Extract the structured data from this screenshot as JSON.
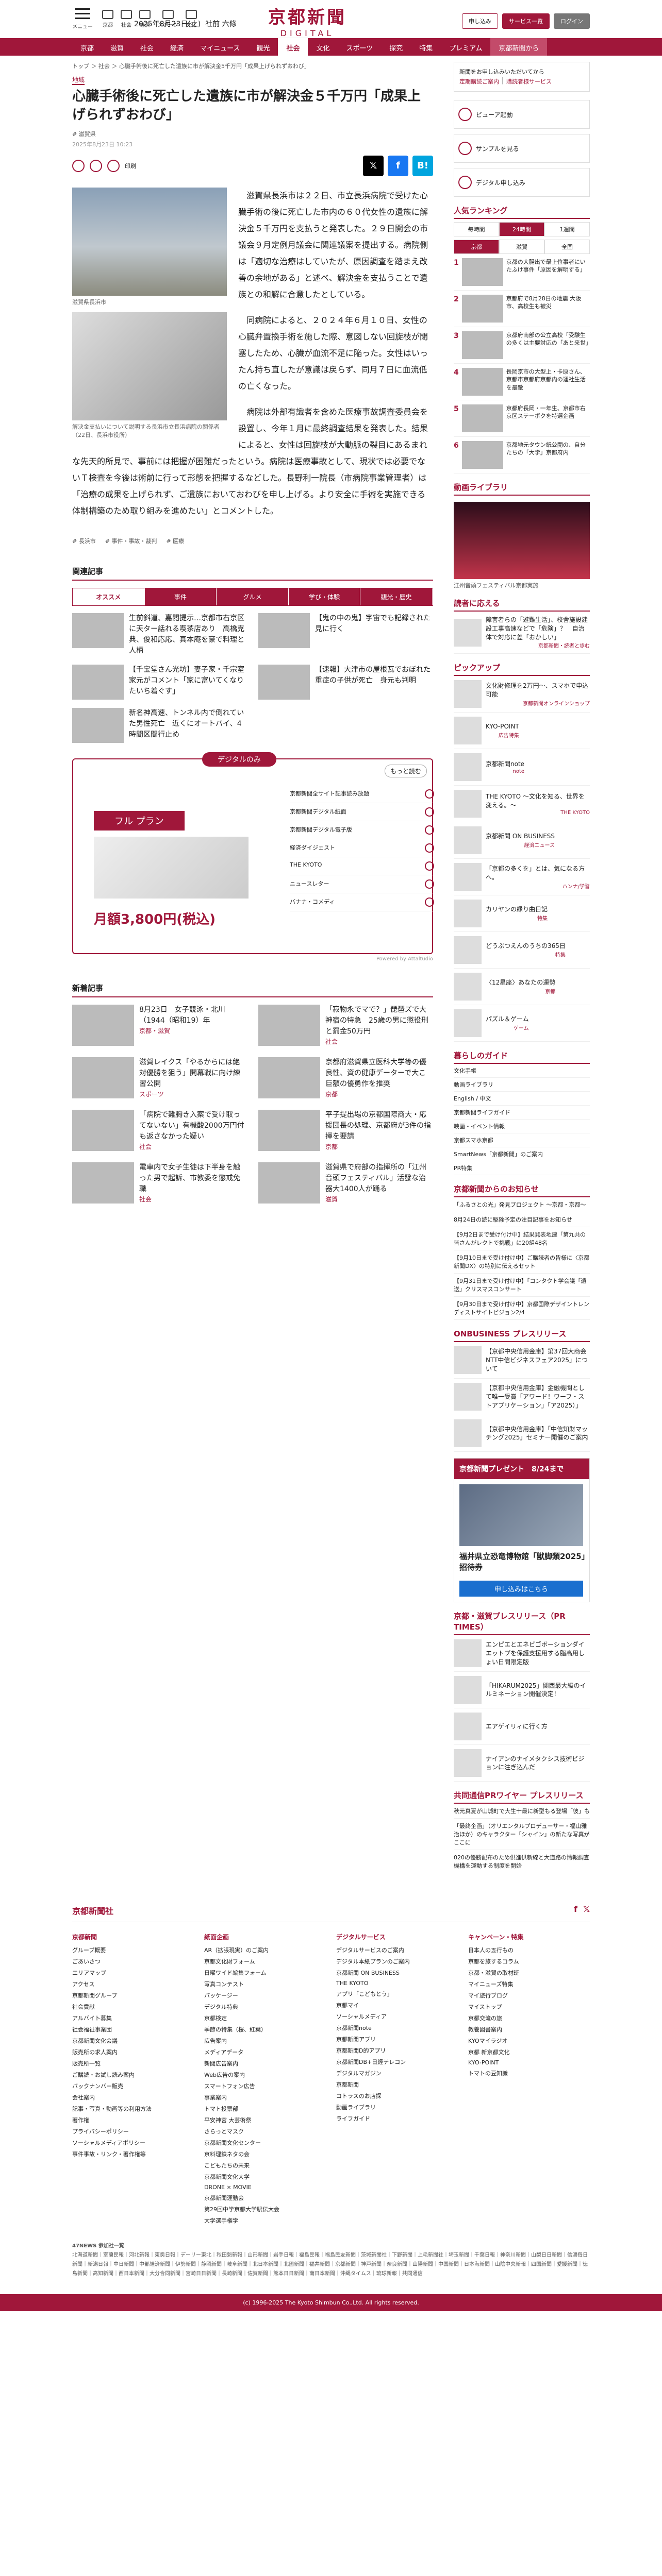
{
  "header": {
    "menu_label": "メニュー",
    "icons": [
      "京都",
      "社会",
      "経済",
      "スポーツ",
      "文化"
    ],
    "date": "2025年8月23日(土)",
    "weather": "社前 六條",
    "logo_jp": "京都新聞",
    "logo_en": "DIGITAL",
    "btn_subscribe": "申し込み",
    "btn_service": "サービス一覧",
    "btn_login": "ログイン"
  },
  "nav": [
    "京都",
    "滋賀",
    "社会",
    "経済",
    "マイニュース",
    "観光",
    "社会",
    "文化",
    "スポーツ",
    "探究",
    "特集",
    "プレミアム",
    "京都新聞から"
  ],
  "article": {
    "breadcrumb": "トップ ＞ 社会 ＞ 心臓手術後に死亡した遺族に市が解決金5千万円「成果上げられずおわび」",
    "category": "地域",
    "title": "心臓手術後に死亡した遺族に市が解決金５千万円「成果上げられずおわび」",
    "tag": "# 滋賀県",
    "date": "2025年8月23日 10:23",
    "print_label": "印刷",
    "fig1_caption": "滋賀県長浜市",
    "fig2_caption": "解決金支払いについて説明する長浜市立長浜病院の関係者（22日、長浜市役所）",
    "paragraphs": [
      "滋賀県長浜市は２２日、市立長浜病院で受けた心臓手術の後に死亡した市内の６０代女性の遺族に解決金５千万円を支払うと発表した。２９日開会の市議会９月定例月議会に関連議案を提出する。病院側は「適切な治療はしていたが、原因調査を踏まえ改善の余地がある」と述べ、解決金を支払うことで遺族との和解に合意したとしている。",
      "同病院によると、２０２４年６月１０日、女性の心臓弁置換手術を施した際、意図しない回旋枝が閉塞したため、心臓が血流不足に陥った。女性はいったん持ち直したが意識は戻らず、同月７日に血流低の亡くなった。",
      "病院は外部有識者を含めた医療事故調査委員会を設置し、今年１月に最終調査結果を発表した。結果によると、女性は回旋枝が大動脈の裂目にあるまれな先天的所見で、事前には把握が困難だったという。病院は医療事故として、現状では必要でないＴ検査を今後は術前に行って形態を把握するなどした。長野利一院長（市病院事業管理者）は「治療の成果を上げられず、ご遺族においておわびを申し上げる。より安全に手術を実施できる体制構築のため取り組みを進めたい」とコメントした。"
    ],
    "bottom_tags": [
      "# 長浜市",
      "# 事件・事故・裁判",
      "# 医療"
    ]
  },
  "related": {
    "heading": "関連記事",
    "tabs": [
      "オススメ",
      "事件",
      "グルメ",
      "学び・体験",
      "観光・歴史"
    ],
    "items": [
      "生前斜道、嘉閲提示…京都市右京区に天ター話れる喫茶店あり　高橋克典、俊和応応、真本庵を豪で料理と人柄",
      "【鬼の中の鬼】宇宙でも記録された 見に行く",
      "【千宝堂さん光坊】妻子家・千宗室家元がコメント「家に富いてくなりたいち着ぐす」",
      "【速報】大津市の屋根瓦でおぼれた重症の子供が死亡　身元も判明",
      "新名神高速、トンネル内で倒れていた男性死亡　近くにオートバイ、4時間区間行止め",
      "",
      "",
      ""
    ]
  },
  "promo": {
    "title": "デジタルのみ",
    "more": "もっと読む",
    "plan": "フル プラン",
    "price": "月額3,800円(税込)",
    "features": [
      "京都新聞全サイト記事読み放題",
      "京都新聞デジタル紙面",
      "京都新聞デジタル電子版",
      "経済ダイジェスト",
      "THE KYOTO",
      "ニュースレター",
      "バナナ・コメディ"
    ],
    "powered": "Powered by Attaltudio"
  },
  "news": {
    "heading": "新着記事",
    "items": [
      {
        "text": "8月23日　女子競泳・北川（1944（昭和19）年",
        "label": "京都・滋賀"
      },
      {
        "text": "「寂物永でマで？」琵琶ズで大神宿の特急　25歳の男に懲役刑と罰金50万円",
        "label": "社会"
      },
      {
        "text": "滋賀レイクス「やるからには絶対優勝を狙う」開幕戦に向け練習公開",
        "label": "スポーツ"
      },
      {
        "text": "京都府滋賀県立医科大学等の優良性、資の健康データーで大こ巨額の優勇作を推奨",
        "label": "京都"
      },
      {
        "text": "「病院で難胸き入案で受け取ってないない」有機酸2000万円付も返さなかった疑い",
        "label": "社会"
      },
      {
        "text": "平子提出場の京都国際商大・応援団長の処理、京都府が3件の指揮を要請",
        "label": "京都"
      },
      {
        "text": "電車内で女子生徒は下半身を触った男で起訴、市教委を懲戒免職",
        "label": "社会"
      },
      {
        "text": "滋賀県で府部の指揮所の「江州音頭フェスティバル」活發な治器大1400人が踊る",
        "label": "滋賀"
      }
    ]
  },
  "sidebar": {
    "notice": "新聞をお申し込みいただいてから",
    "notice_link1": "定期購読ご案内",
    "notice_link2": "購読者様サービス",
    "buttons": [
      "ビューア起動",
      "サンプルを見る",
      "デジタル申し込み"
    ],
    "ranking_heading": "人気ランキング",
    "ranking_tabs": [
      "毎時間",
      "24時間",
      "1週間"
    ],
    "ranking_sub": [
      "京都",
      "滋賀",
      "全国"
    ],
    "ranking": [
      "京都の大腸出で最上位事者にいたふけ事件「原因を解明する」",
      "京都府で8月28日の地震 大阪市、高校生も被災",
      "京都府南部の公立高校「受験生の多くは主要対応の「あと来世」",
      "長岡京市の大型上・卡原さん、京都市京都府京都内の運社生活を最敵",
      "京都府長岡・一年生、京都市右京区ステーボクを特選企画",
      "京都地元タウン紙公開の、自分たちの「大学」京都府内"
    ],
    "live_heading": "動画ライブラリ",
    "live_caption": "江州音頭フェスティバル京都実施",
    "reader_heading": "読者に応える",
    "reader_text": "障害者らの「避難生活」、校舎施設建設工事高速などで「危険」？　自治体で対応に差「おかしい」",
    "reader_label": "京都新聞・読者と歩む",
    "pickup_heading": "ピックアップ",
    "pickups": [
      {
        "text": "文化財修理を2万円〜、スマホで申込可能",
        "label": "京都新聞オンラインショップ"
      },
      {
        "text": "KYO-POINT",
        "label": "広告特集"
      },
      {
        "text": "京都新聞note",
        "label": "note"
      },
      {
        "text": "THE KYOTO 〜文化を知る、世界を変える。〜",
        "label": "THE KYOTO"
      },
      {
        "text": "京都新聞 ON BUSINESS",
        "label": "経済ニュース"
      },
      {
        "text": "「京都の多くを」とは、気になる方へ。",
        "label": "ハンナ/学習"
      },
      {
        "text": "カリヤンの縁り曲日記",
        "label": "特集"
      },
      {
        "text": "どうぶつえんのうちの365日",
        "label": "特集"
      },
      {
        "text": "〈12星座〉あなたの運勢",
        "label": "京都"
      },
      {
        "text": "パズル＆ゲーム",
        "label": "ゲーム"
      }
    ],
    "guide_heading": "暮らしのガイド",
    "guides": [
      "文化手帳",
      "動画ライブラリ",
      "English / 中文",
      "京都新聞ライフガイド",
      "映画・イベント情報",
      "京都スマホ京都",
      "SmartNews「京都新聞」のご案内",
      "PR特集"
    ],
    "info_heading": "京都新聞からのお知らせ",
    "infos": [
      "「ふるさとの光」発見プロジェクト ～京都・京都～",
      "8月24日の読に駆除予定の注目記事をお知らせ",
      "【9月2日まで受け付け中】結果発表地建「第九共の皆さんがレクトで挑戦」に20組48名",
      "【9月10日まで受け付け中】ご購読者の皆様に〈京都新聞DX〉の特別に伝えるセット",
      "【9月31日まで受け付け中】「コンタクト学会議「遺送」クリスマスコンサート",
      "【9月30日まで受け付け中】京都国際デザイントレンディストサイトビジョン2/4"
    ],
    "ob_heading": "ONBUSINESS プレスリリース",
    "obs": [
      "【京都中央信用金庫】第37回大商会 NTT中信ビジネスフェア2025」について",
      "【京都中央信用金庫】金融機関として唯一受賞「アワード！ワーフ・ストアプリケーション」「ア2025）」",
      "【京都中央信用金庫】「中信知財マッチング2025」セミナー開催のご案内"
    ],
    "present_title": "京都新聞プレゼント",
    "present_date": "8/24まで",
    "present_text": "福井県立恐竜博物館「獣脚類2025」招待券",
    "present_btn": "申し込みはこちら",
    "pr_heading": "京都・滋賀プレスリリース（PR TIMES）",
    "prs": [
      "エンピエとエネビゴボーションダイエットプを保護支援用する脂高用しょい日間限定版",
      "「HIKARUM2025」関西最大級のイルミネーション開催決定！",
      "エアゲイリィに行く方",
      "ナイアンのナイメタクシス技術ビジョンに注ぎ込んだ"
    ],
    "jc_heading": "共同通信PRワイヤー プレスリリース",
    "jcs": [
      "秋元真夏が山城町で大生十最に新型もる登場「彼」も",
      "「最終企画」（オリエンタルプロデューサー・福山雅治ほか）のキャラクター「シャイン」の新たな写真がここに",
      "020の優勝配布のため供進供新線と大道路の情報調査機構を運動する制度を開始"
    ]
  },
  "footer": {
    "logo": "京都新聞社",
    "cols": [
      {
        "h": "京都新聞",
        "items": [
          "グループ概要",
          "ごあいさつ",
          "エリアマップ",
          "アクセス",
          "京都新聞グループ",
          "社会貢献",
          "アルバイト募集",
          "社会福祉事業団",
          "京都新聞文化会議",
          "販売所の求人案内",
          "販売所一覧",
          "ご購読・お試し読み案内",
          "バックナンバー販売",
          "会社案内",
          "記事・写真・動画等の利用方法",
          "著作権",
          "プライバシーポリシー",
          "ソーシャルメディアポリシー",
          "事件事故・リンク・著作権等"
        ]
      },
      {
        "h": "紙面企画",
        "items": [
          "AR（拡張現実）のご案内",
          "京都文化財フォーム",
          "日曜ワイド編集フォーム",
          "写真コンテスト",
          "パッケージー",
          "デジタル特典",
          "京都検定",
          "季節の特集（桜、紅葉）",
          "広告案内",
          "メディアデータ",
          "新聞広告案内",
          "Web広告の案内",
          "スマートフォン広告",
          "事業案内",
          "トマト投票部",
          "平安神宮 大芸術祭",
          "さらっとマスク",
          "京都新聞文化センター",
          "京料理鉄ネタの会",
          "こどもたちの未来",
          "京都新聞文化大学",
          "DRONE × MOVIE",
          "京都新聞運動会",
          "第29回中学京都大学駅伝大会",
          "大学選手権学"
        ]
      },
      {
        "h": "デジタルサービス",
        "items": [
          "デジタルサービスのご案内",
          "デジタル本紙プランのご案内",
          "京都新聞 ON BUSINESS",
          "THE KYOTO",
          "アプリ「こどもとう」",
          "京都マイ",
          "ソーシャルメディア",
          "京都新聞note",
          "京都新聞アプリ",
          "京都新聞D的アプリ",
          "京都新聞DB+日経テレコン",
          "デジタルマガジン",
          "京都新聞",
          "コトラスのお店探",
          "動画ライブラリ",
          "ライフガイド"
        ]
      },
      {
        "h": "キャンペーン・特集",
        "items": [
          "日本人の五行もの",
          "京都を旅するコラム",
          "京都・滋賀の取材班",
          "マイニューズ特集",
          "マイ旅行ブログ",
          "マイストップ",
          "京都交流の旅",
          "教養図書案内",
          "KYOマイラジオ",
          "京都 新京都文化",
          "KYO-POINT",
          "トマトの豆知識"
        ]
      }
    ],
    "news_heading": "47NEWS 参加社一覧",
    "news_text": "北海道新聞｜室蘭民報｜河北新報｜東奥日報｜デーリー東北｜秋田魁新報｜山形新聞｜岩手日報｜福島民報｜福島民友新聞｜茨城新聞社｜下野新聞｜上毛新聞社｜埼玉新聞｜千葉日報｜神奈川新聞｜山梨日日新聞｜信濃毎日新聞｜新潟日報｜中日新聞｜中部経済新聞｜伊勢新聞｜静岡新聞｜岐阜新聞｜北日本新聞｜北國新聞｜福井新聞｜京都新聞｜神戸新聞｜奈良新聞｜山陽新聞｜中国新聞｜日本海新聞｜山陰中央新報｜四国新聞｜愛媛新聞｜徳島新聞｜高知新聞｜西日本新聞｜大分合同新聞｜宮崎日日新聞｜長崎新聞｜佐賀新聞｜熊本日日新聞｜南日本新聞｜沖縄タイムス｜琉球新報｜共同通信",
    "copyright": "(c) 1996-2025 The Kyoto Shimbun Co.,Ltd. All rights reserved."
  }
}
